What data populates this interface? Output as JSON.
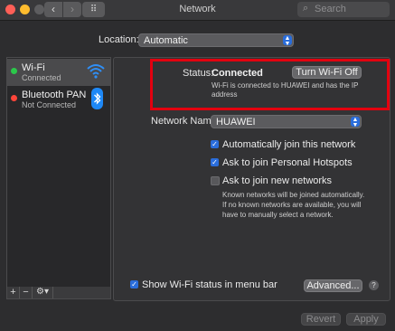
{
  "window": {
    "title": "Network"
  },
  "toolbar": {
    "search_placeholder": "Search",
    "back_icon": "‹",
    "forward_icon": "›",
    "grid_icon": "⠿"
  },
  "location": {
    "label": "Location:",
    "value": "Automatic"
  },
  "sidebar": {
    "items": [
      {
        "name": "Wi-Fi",
        "status": "Connected",
        "dot_color": "#2bc84a",
        "icon": "wifi-icon"
      },
      {
        "name": "Bluetooth PAN",
        "status": "Not Connected",
        "dot_color": "#ff453a",
        "icon": "bluetooth-icon"
      }
    ],
    "add_label": "+",
    "remove_label": "−",
    "gear_label": "⚙▾"
  },
  "wifi": {
    "status_label": "Status:",
    "status_value": "Connected",
    "turn_off_label": "Turn Wi-Fi Off",
    "status_desc": "Wi-Fi is connected to HUAWEI              and has the IP address",
    "network_name_label": "Network Name:",
    "network_name_value": "HUAWEI",
    "options": [
      {
        "label": "Automatically join this network",
        "checked": true
      },
      {
        "label": "Ask to join Personal Hotspots",
        "checked": true
      },
      {
        "label": "Ask to join new networks",
        "checked": false
      }
    ],
    "note": "Known networks will be joined automatically. If no known networks are available, you will have to manually select a network.",
    "show_status_label": "Show Wi-Fi status in menu bar",
    "show_status_checked": true,
    "advanced_label": "Advanced...",
    "help_label": "?"
  },
  "footer": {
    "revert_label": "Revert",
    "apply_label": "Apply"
  },
  "colors": {
    "accent": "#2a6ddb",
    "highlight_box": "#e3000f"
  }
}
